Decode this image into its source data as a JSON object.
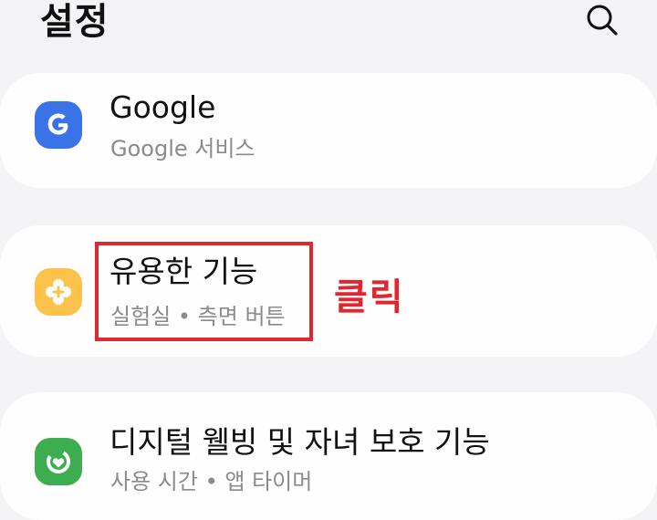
{
  "header": {
    "title": "설정",
    "search_icon": "search-icon"
  },
  "items": [
    {
      "title": "Google",
      "subtitle": "Google 서비스",
      "icon": "google-icon",
      "icon_color": "#3a72e8"
    },
    {
      "title": "유용한 기능",
      "subtitle": "실험실 • 측면 버튼",
      "icon": "advanced-features-icon",
      "icon_color": "#fbc34a"
    },
    {
      "title": "디지털 웰빙 및 자녀 보호 기능",
      "subtitle": "사용 시간 • 앱 타이머",
      "icon": "digital-wellbeing-icon",
      "icon_color": "#3cae4f"
    }
  ],
  "annotation": {
    "text": "클릭",
    "color": "#e0262e"
  }
}
